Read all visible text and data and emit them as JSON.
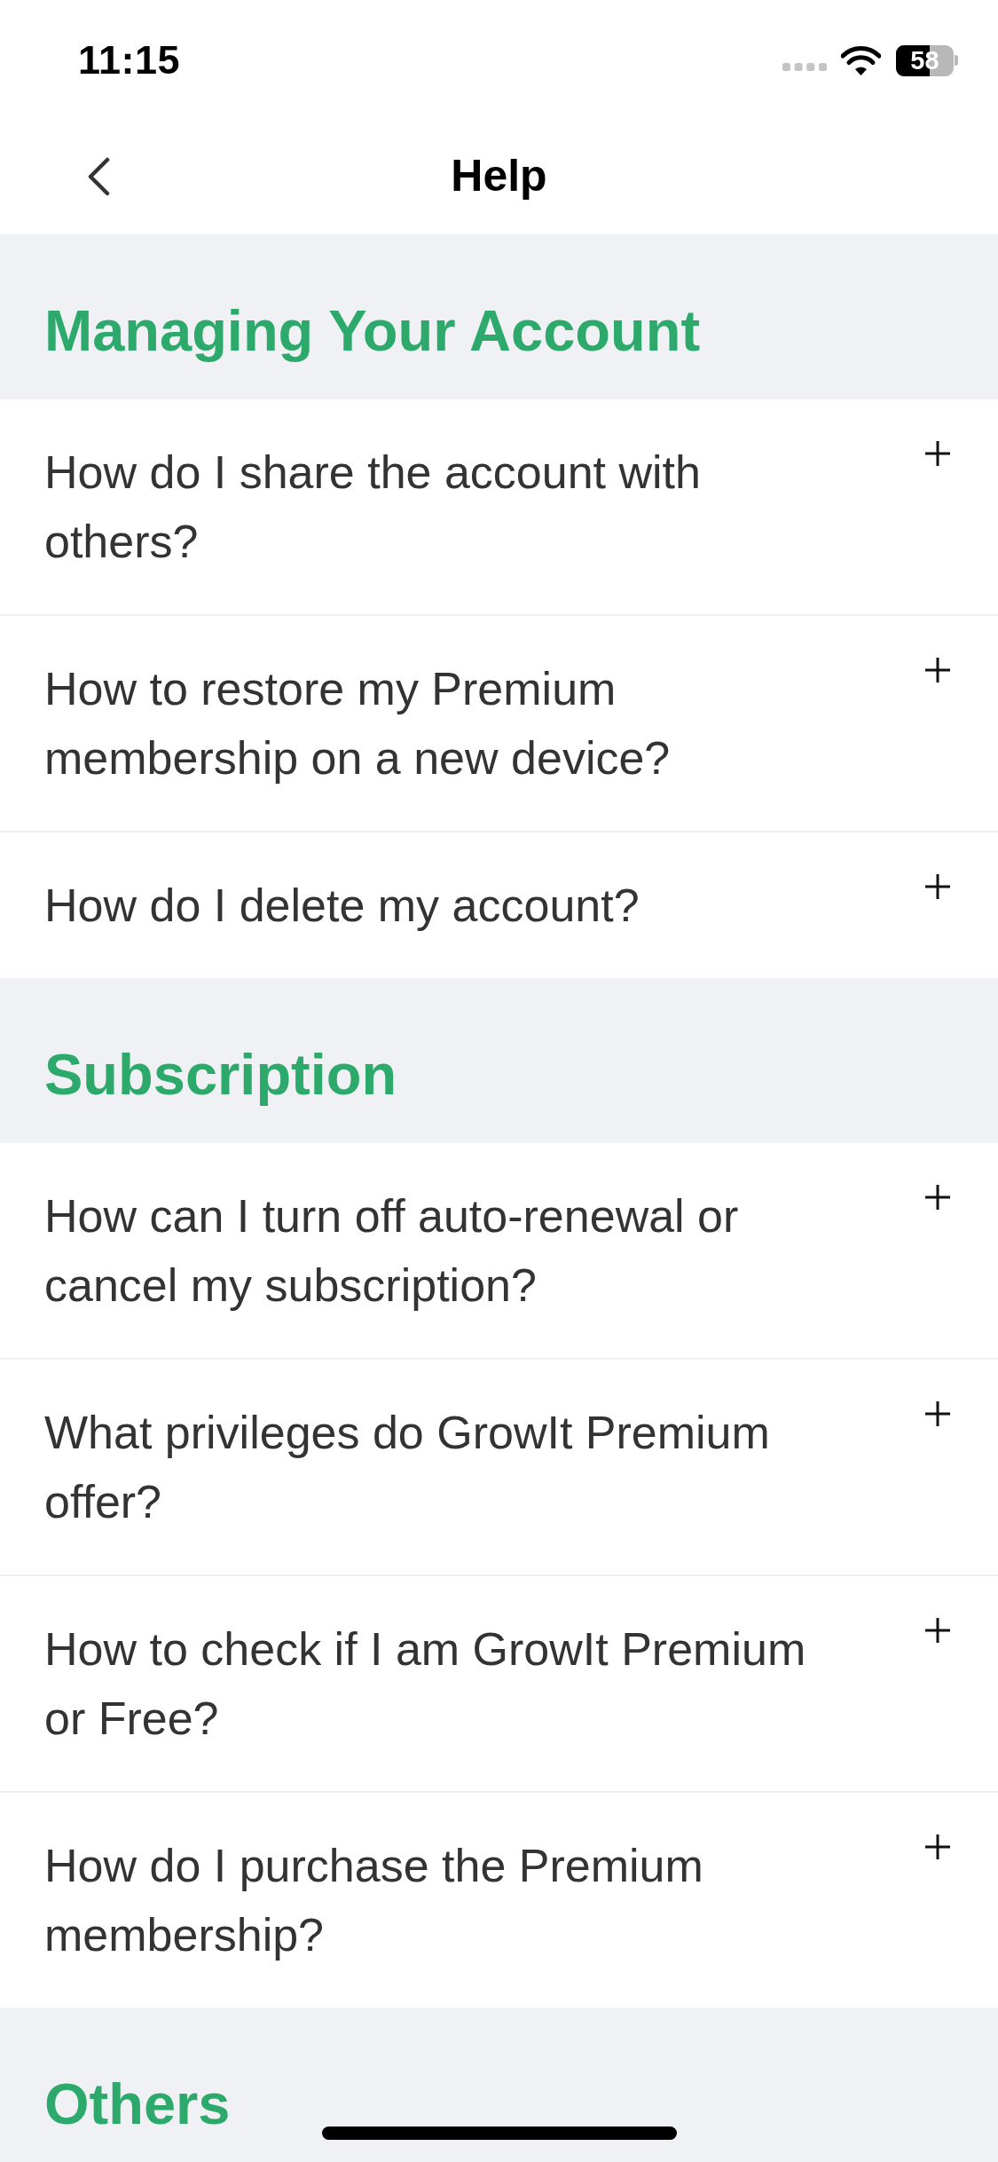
{
  "status_bar": {
    "time": "11:15",
    "battery": "58"
  },
  "nav_bar": {
    "title": "Help"
  },
  "sections": [
    {
      "title": "Managing Your Account",
      "items": [
        {
          "question": "How do I share the account with others?",
          "expanded": false
        },
        {
          "question": "How to restore my Premium membership on a new device?",
          "expanded": false
        },
        {
          "question": "How do I delete my account?",
          "expanded": false
        }
      ]
    },
    {
      "title": "Subscription",
      "items": [
        {
          "question": "How can I turn off auto-renewal or cancel my subscription?",
          "expanded": false
        },
        {
          "question": "What privileges do GrowIt Premium offer?",
          "expanded": false
        },
        {
          "question": "How to check if I am GrowIt Premium or Free?",
          "expanded": false
        },
        {
          "question": "How do I purchase the Premium membership?",
          "expanded": false
        }
      ]
    },
    {
      "title": "Others"
    }
  ]
}
